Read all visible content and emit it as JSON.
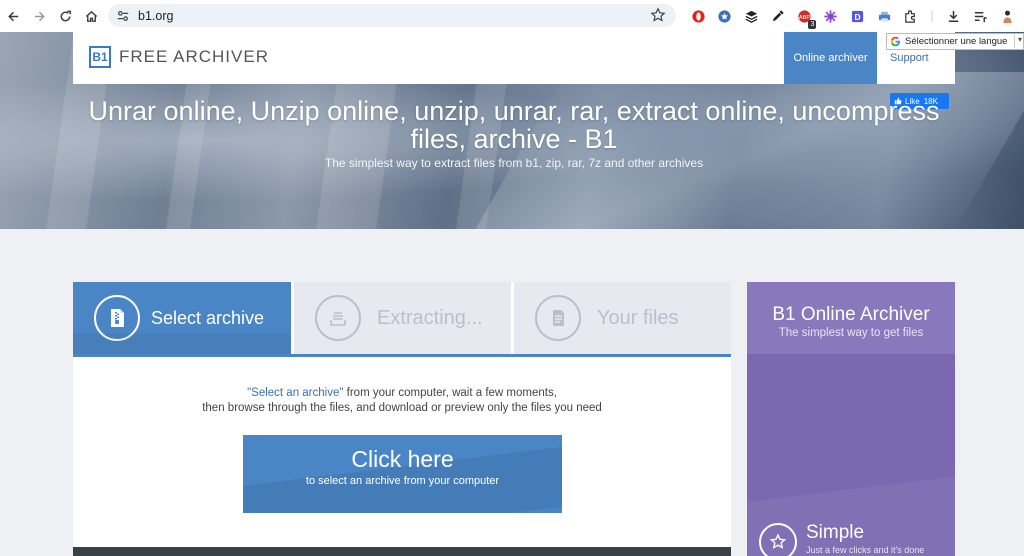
{
  "browser": {
    "url": "b1.org",
    "ext_badge": "3"
  },
  "header": {
    "logo_mark": "B1",
    "logo_text": "FREE ARCHIVER",
    "nav_online": "Online archiver",
    "nav_support": "Support"
  },
  "translate": {
    "label": "Sélectionner une langue"
  },
  "like": {
    "label": "Like",
    "count": "18K"
  },
  "hero": {
    "title": "Unrar online, Unzip online, unzip, unrar, rar, extract online, uncompress files, archive - B1",
    "subtitle": "The simplest way to extract files from b1, zip, rar, 7z and other archives"
  },
  "steps": {
    "select": "Select archive",
    "extracting": "Extracting...",
    "files": "Your files"
  },
  "description": {
    "highlight": "\"Select an archive\"",
    "line1_rest": " from your computer, wait a few moments,",
    "line2": "then browse through the files, and download or preview only the files you need"
  },
  "cta": {
    "main": "Click here",
    "sub": "to select an archive from your computer"
  },
  "sidebar": {
    "title": "B1 Online Archiver",
    "subtitle": "The simplest way to get files",
    "feature_title": "Simple",
    "feature_sub": "Just a few clicks and it's done"
  },
  "colors": {
    "accent_blue": "#4a86c5",
    "sidebar_purple": "#7b68b1",
    "facebook": "#1877f2"
  }
}
